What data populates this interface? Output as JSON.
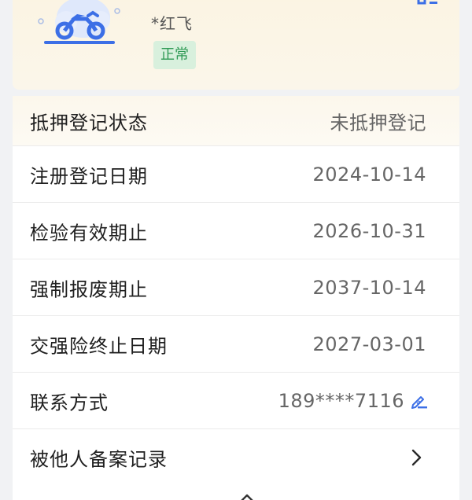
{
  "vehicle": {
    "owner_name": "*红飞",
    "status": "正常"
  },
  "info_rows": [
    {
      "label": "抵押登记状态",
      "value": "未抵押登记"
    },
    {
      "label": "注册登记日期",
      "value": "2024-10-14"
    },
    {
      "label": "检验有效期止",
      "value": "2026-10-31"
    },
    {
      "label": "强制报废期止",
      "value": "2037-10-14"
    },
    {
      "label": "交强险终止日期",
      "value": "2027-03-01"
    },
    {
      "label": "联系方式",
      "value": "189****7116"
    },
    {
      "label": "被他人备案记录",
      "value": ""
    }
  ],
  "icons": {
    "edit": "edit-pen-icon",
    "chevron": "chevron-right-icon",
    "collapse": "chevron-up-icon",
    "qr": "qr-code-icon",
    "vehicle": "motorcycle-icon"
  },
  "colors": {
    "accent_blue": "#3c6fe6",
    "status_green_bg": "#d8f0dd",
    "status_green_text": "#2f9a55",
    "card_bg": "#fbf4e2"
  }
}
